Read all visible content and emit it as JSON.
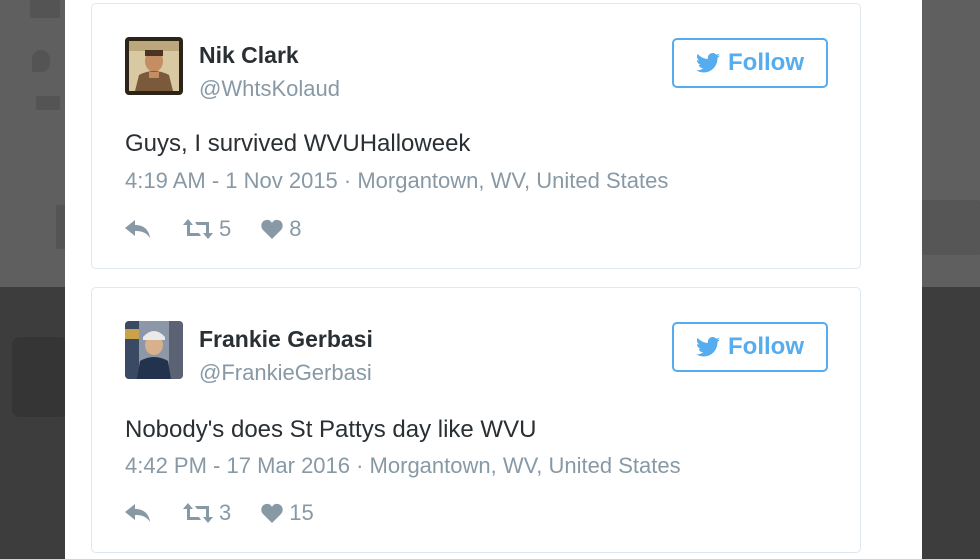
{
  "tweets": [
    {
      "name": "Nik Clark",
      "handle": "@WhtsKolaud",
      "follow_label": "Follow",
      "text": "Guys, I survived WVUHalloweek",
      "meta": "4:19 AM - 1 Nov 2015 · Morgantown, WV, United States",
      "retweets": "5",
      "likes": "8"
    },
    {
      "name": "Frankie Gerbasi",
      "handle": "@FrankieGerbasi",
      "follow_label": "Follow",
      "text": "Nobody's does St Pattys day like WVU",
      "meta": "4:42 PM - 17 Mar 2016 · Morgantown, WV, United States",
      "retweets": "3",
      "likes": "15"
    }
  ],
  "colors": {
    "accent": "#55acee",
    "text": "#292f33",
    "muted": "#8899a6",
    "border": "#e1e8ed"
  },
  "icons": [
    "twitter-bird-icon",
    "reply-icon",
    "retweet-icon",
    "heart-icon"
  ]
}
